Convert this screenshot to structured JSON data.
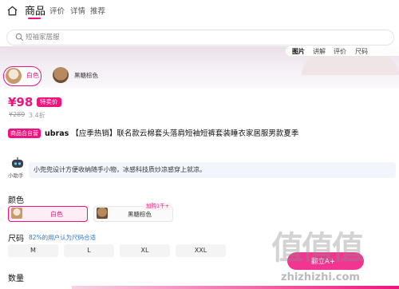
{
  "nav": {
    "tabs": [
      "商品",
      "评价",
      "详情",
      "推荐"
    ]
  },
  "search": {
    "placeholder": "短袖家居服"
  },
  "gallery": {
    "tabs": [
      "图片",
      "讲解",
      "评价",
      "尺码"
    ]
  },
  "banner_colors": [
    {
      "label": "白色"
    },
    {
      "label": "黑糖棕色"
    }
  ],
  "price": {
    "current": "¥98",
    "badge": "特卖价",
    "original": "¥289",
    "discount": "3.4折"
  },
  "product": {
    "mall_badge": "商品合自营",
    "brand": "ubras",
    "title": "【应季热销】联名款云棉套头落肩短袖短裤套装睡衣家居服男款夏季"
  },
  "assistant": {
    "name": "小助手",
    "text": "小兜兜设计方便收纳随手小物，冰感科技质炒凉感穿上就凉。"
  },
  "color_section": {
    "heading": "颜色",
    "options": [
      {
        "label": "白色",
        "selected": true
      },
      {
        "label": "黑糖棕色",
        "selected": false,
        "tag": "加购1千+"
      }
    ]
  },
  "size_section": {
    "heading": "尺码",
    "recommendation": "82%的用户认为尺码合适",
    "options": [
      "M",
      "L",
      "XL",
      "XXL"
    ]
  },
  "quantity_section": {
    "heading": "数量"
  },
  "floating_button": {
    "label": "翻立A+"
  },
  "watermark": {
    "glyphs": "值值值",
    "url": "zhizhizhi.com"
  },
  "colors": {
    "accent": "#f0127e",
    "link": "#2a76d2"
  }
}
